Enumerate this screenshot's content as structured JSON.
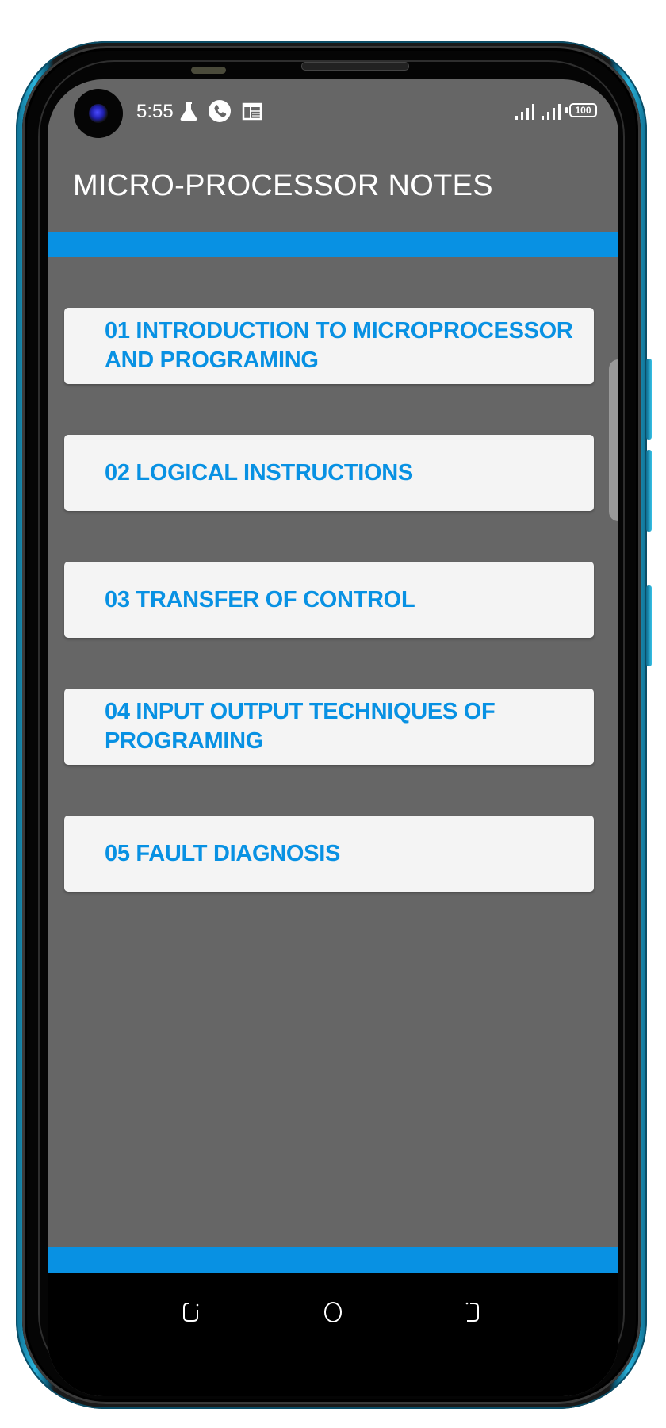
{
  "device": {
    "frame_color": "#1f9cc6",
    "accent_color": "#0891e3",
    "background_color": "#666666",
    "card_color": "#f4f4f4"
  },
  "status_bar": {
    "time": "5:55",
    "left_icons": [
      "flask-icon",
      "phone-call-icon",
      "calendar-icon"
    ],
    "right_icons": [
      "signal-sim1-icon",
      "signal-sim2-icon",
      "battery-icon"
    ],
    "battery_level": "100"
  },
  "app_bar": {
    "title": "MICRO-PROCESSOR NOTES"
  },
  "chapters": [
    {
      "label": "01 INTRODUCTION TO MICROPROCESSOR AND PROGRAMING"
    },
    {
      "label": "02 LOGICAL INSTRUCTIONS"
    },
    {
      "label": "03 TRANSFER OF CONTROL"
    },
    {
      "label": "04 INPUT OUTPUT TECHNIQUES OF PROGRAMING"
    },
    {
      "label": "05 FAULT DIAGNOSIS"
    }
  ],
  "nav_bar": {
    "buttons": [
      "recent-apps",
      "home",
      "back"
    ]
  }
}
